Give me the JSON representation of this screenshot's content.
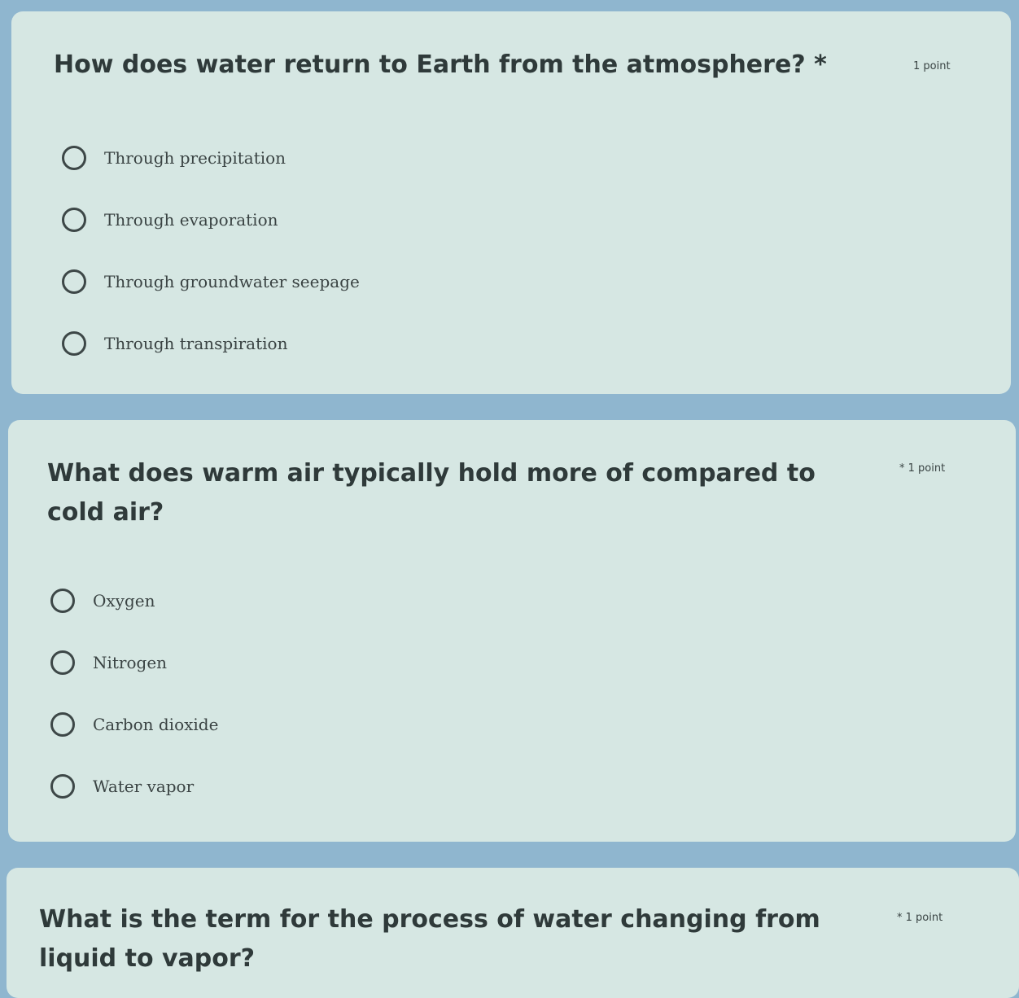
{
  "questions": [
    {
      "text": "How does water return to Earth from the atmosphere? *",
      "points": "1 point",
      "options": [
        "Through precipitation",
        "Through evaporation",
        "Through groundwater seepage",
        "Through transpiration"
      ]
    },
    {
      "text": "What does warm air typically hold more of compared to cold air?",
      "points": "* 1 point",
      "options": [
        "Oxygen",
        "Nitrogen",
        "Carbon dioxide",
        "Water vapor"
      ]
    },
    {
      "text": "What is the term for the process of water changing from liquid to vapor?",
      "points": "* 1 point",
      "options": []
    }
  ]
}
